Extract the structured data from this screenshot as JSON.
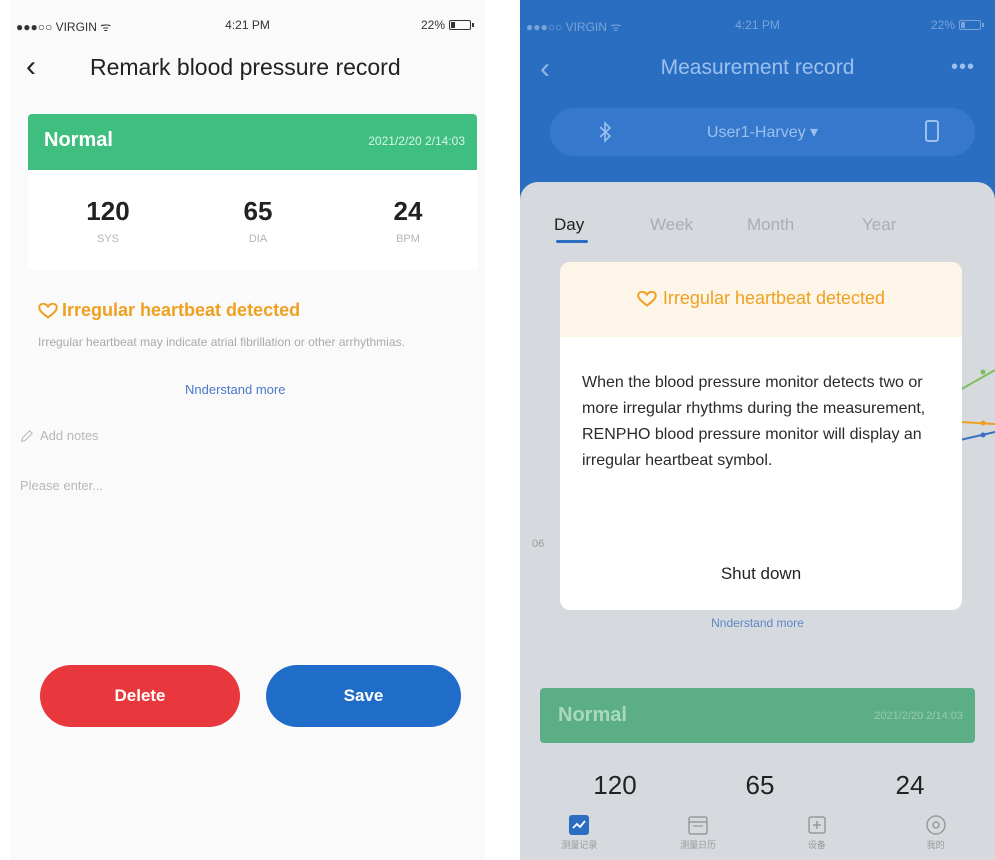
{
  "left": {
    "status": {
      "carrier": "●●●○○ VIRGIN ᯤ",
      "time": "4:21 PM",
      "battery": "22%",
      "battery_level": 0.22
    },
    "nav": {
      "back_glyph": "‹",
      "title": "Remark blood pressure record"
    },
    "banner": {
      "label": "Normal",
      "date": "2021/2/20 2/14:03"
    },
    "metrics": [
      {
        "value": "120",
        "unit": "SYS"
      },
      {
        "value": "65",
        "unit": "DIA"
      },
      {
        "value": "24",
        "unit": "BPM"
      }
    ],
    "warning": {
      "title": "Irregular heartbeat detected",
      "description": "Irregular heartbeat may indicate atrial fibrillation or other arrhythmias.",
      "link": "Nnderstand more"
    },
    "notes": {
      "label": "Add notes",
      "placeholder": "Please enter..."
    },
    "buttons": {
      "delete": "Delete",
      "save": "Save"
    }
  },
  "right": {
    "status": {
      "carrier": "●●●○○ VIRGIN ᯤ",
      "time": "4:21 PM",
      "battery": "22%",
      "battery_level": 0.22
    },
    "nav": {
      "back_glyph": "‹",
      "title": "Measurement record",
      "more": "•••"
    },
    "user_selector": "User1-Harvey ▾",
    "tabs": [
      "Day",
      "Week",
      "Month",
      "Year"
    ],
    "chart_tick": "06",
    "modal": {
      "title": "Irregular heartbeat detected",
      "body": "When the blood pressure monitor detects two or more irregular rhythms during the measurement, RENPHO blood pressure monitor will display an irregular heartbeat symbol.",
      "button": "Shut down"
    },
    "link_behind": "Nnderstand more",
    "banner": {
      "label": "Normal",
      "date": "2021/2/20 2/14:03"
    },
    "metrics": [
      "120",
      "65",
      "24"
    ],
    "tabbar": [
      "测量记录",
      "测量日历",
      "设备",
      "我的"
    ]
  },
  "colors": {
    "green": "#3fbf7f",
    "blue": "#2a6ec2",
    "red": "#e8383e",
    "warning": "#f0a020"
  }
}
